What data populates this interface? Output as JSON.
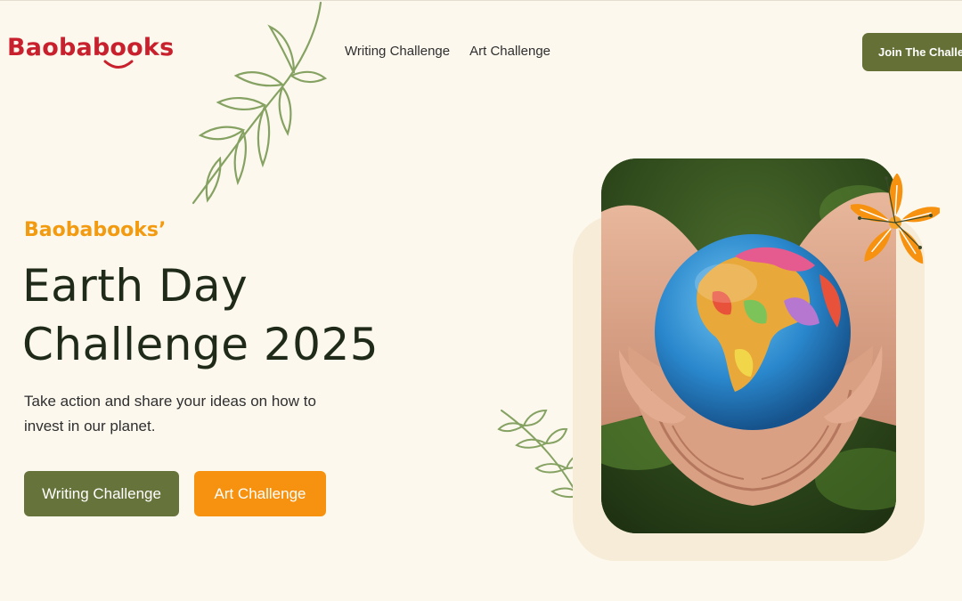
{
  "header": {
    "logo_text": "Baobabooks",
    "nav": [
      {
        "label": "Writing Challenge"
      },
      {
        "label": "Art Challenge"
      }
    ],
    "cta_label": "Join The Challenge"
  },
  "hero": {
    "eyebrow": "Baobabooks’",
    "title_line1": "Earth Day",
    "title_line2": "Challenge 2025",
    "subtitle": "Take action and share your ideas on how to invest in our planet.",
    "buttons": {
      "writing_label": "Writing Challenge",
      "art_label": "Art Challenge"
    }
  },
  "icons": [
    "leaf-branch-icon",
    "flower-icon",
    "smile-icon"
  ],
  "colors": {
    "background": "#fcf8ee",
    "brand_red": "#c8202c",
    "accent_orange": "#f6920f",
    "olive": "#66733a",
    "title_dark": "#1f2a19"
  }
}
